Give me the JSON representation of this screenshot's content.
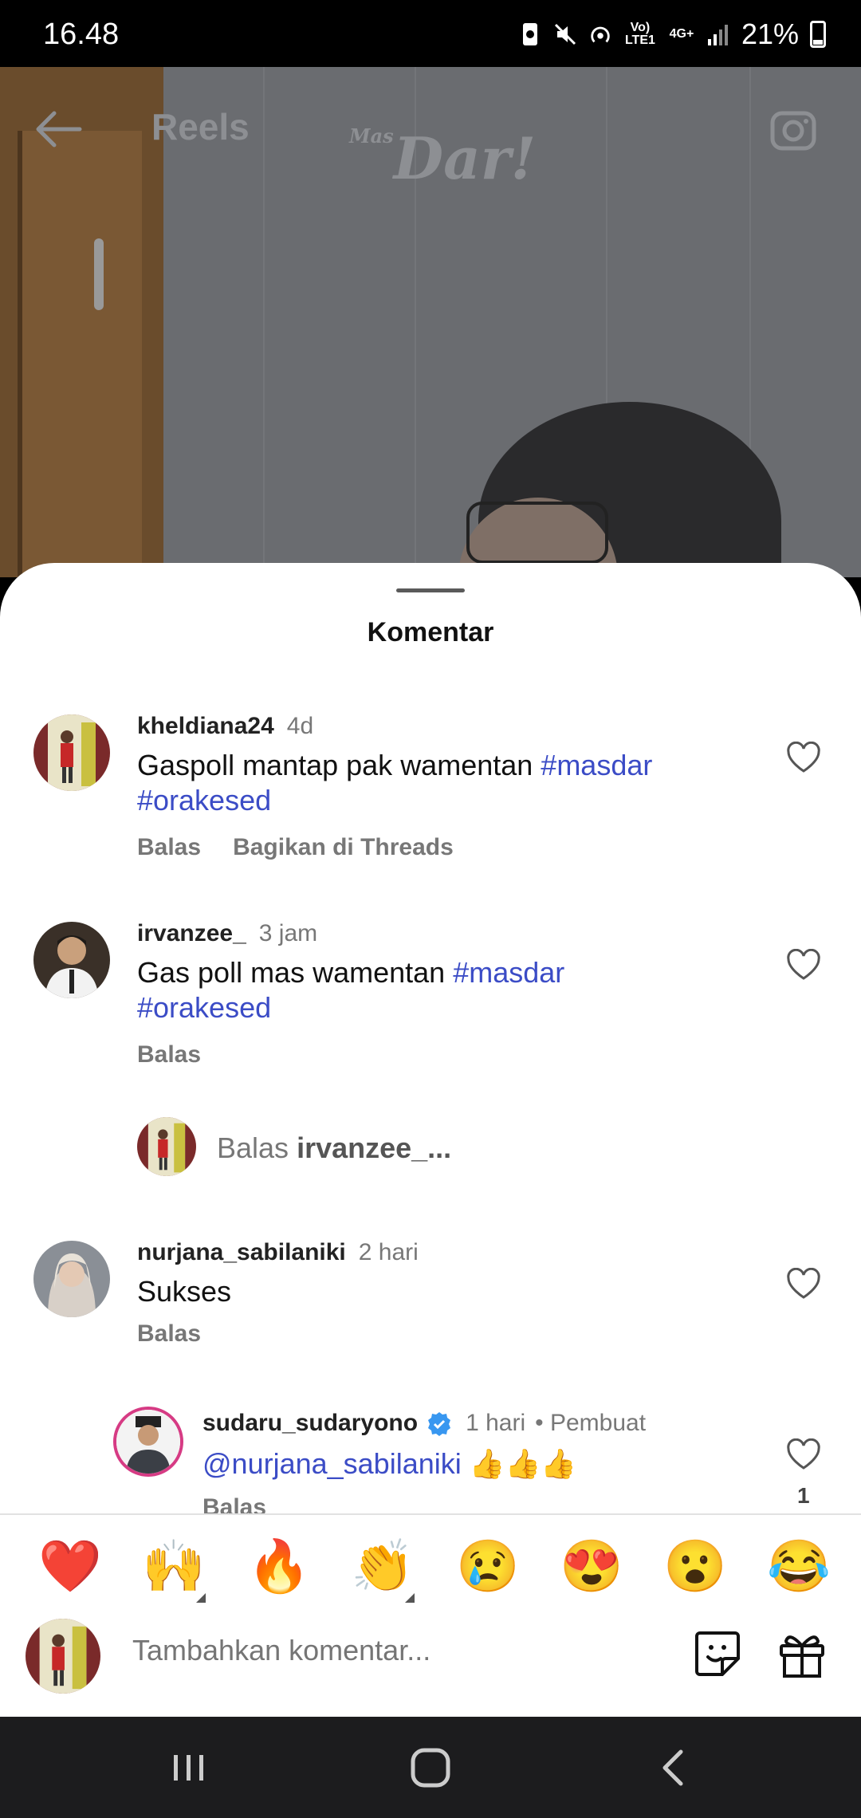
{
  "status_bar": {
    "time": "16.48",
    "volte": "Vo) LTE1",
    "network": "4G+",
    "battery": "21%"
  },
  "topbar": {
    "title": "Reels",
    "logo": "Dar!",
    "logo_small": "Mas"
  },
  "sheet": {
    "title": "Komentar"
  },
  "comments": [
    {
      "username": "kheldiana24",
      "time": "4d",
      "text": "Gaspoll mantap pak wamentan ",
      "tags": [
        "#masdar",
        "#orakesed"
      ],
      "actions": [
        "Balas",
        "Bagikan di Threads"
      ]
    },
    {
      "username": "irvanzee_",
      "time": "3 jam",
      "text": "Gas poll mas wamentan  ",
      "tags": [
        "#masdar",
        "#orakesed"
      ],
      "actions": [
        "Balas"
      ]
    },
    {
      "username": "nurjana_sabilaniki",
      "time": "2 hari",
      "text": "Sukses",
      "actions": [
        "Balas"
      ]
    },
    {
      "username": "sudaru_sudaryono",
      "time": "1 hari",
      "creator_label": "Pembuat",
      "mention": "@nurjana_sabilaniki",
      "emoji": "👍👍👍",
      "likes": "1",
      "actions": [
        "Balas"
      ]
    }
  ],
  "reply_prompt": {
    "prefix": "Balas ",
    "target": "irvanzee_..."
  },
  "emoji_bar": [
    "❤️",
    "🙌",
    "🔥",
    "👏",
    "😢",
    "😍",
    "😮",
    "😂"
  ],
  "input": {
    "placeholder": "Tambahkan komentar..."
  },
  "colors": {
    "hashtag": "#3b4cc6",
    "verified": "#3897f0",
    "like_heart": "#ed4956"
  }
}
